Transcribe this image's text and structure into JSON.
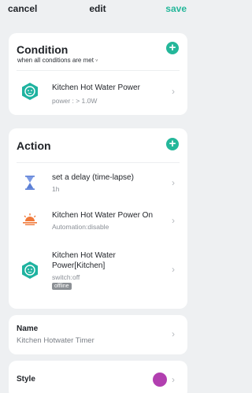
{
  "header": {
    "cancel_label": "cancel",
    "title": "edit",
    "save_label": "save"
  },
  "condition": {
    "title": "Condition",
    "subtitle": "when all conditions are met",
    "subtitle_caret": "˅",
    "add_label": "+",
    "items": [
      {
        "name": "Kitchen Hot Water Power",
        "detail": "power : > 1.0W",
        "icon": "smart-plug-icon"
      }
    ]
  },
  "action": {
    "title": "Action",
    "add_label": "+",
    "items": [
      {
        "name": "set a delay (time-lapse)",
        "detail": "1h",
        "icon": "hourglass-icon"
      },
      {
        "name": "Kitchen Hot Water Power On",
        "detail": "Automation:disable",
        "icon": "sunset-icon"
      },
      {
        "name": "Kitchen Hot Water Power[Kitchen]",
        "detail": "switch:off",
        "badge": "offline",
        "icon": "smart-plug-icon"
      }
    ]
  },
  "name_section": {
    "label": "Name",
    "value": "Kitchen Hotwater Timer"
  },
  "style_section": {
    "label": "Style",
    "color": "#b23fb0"
  },
  "chevron": "›",
  "colors": {
    "accent": "#24b79a",
    "device_icon": "#1fb3a0",
    "delay_icon": "#5b7fd6",
    "scene_icon": "#f07a3b"
  }
}
